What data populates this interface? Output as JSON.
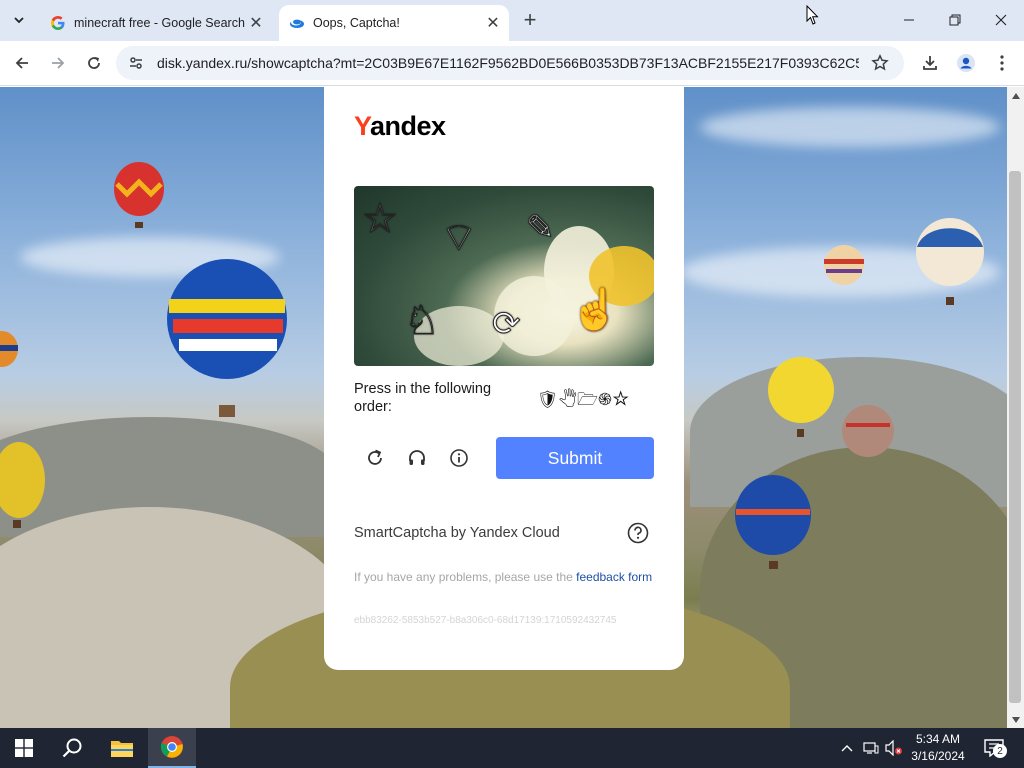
{
  "browser": {
    "tabs": [
      {
        "title": "minecraft free - Google Search",
        "favicon": "google-g-icon",
        "active": false
      },
      {
        "title": "Oops, Captcha!",
        "favicon": "yandex-disk-icon",
        "active": true
      }
    ],
    "address_bar": {
      "url": "disk.yandex.ru/showcaptcha?mt=2C03B9E67E1162F9562BD0E566B0353DB73F13ACBF2155E217F0393C62C5BAC..."
    }
  },
  "captcha": {
    "logo": {
      "first_letter": "Y",
      "rest": "andex"
    },
    "instruction": "Press in the following order:",
    "order_symbols": "🛡🖑🗁֍☆",
    "submit_label": "Submit",
    "footer": "SmartCaptcha by Yandex Cloud",
    "problems_text": "If you have any problems, please use the ",
    "feedback_link": "feedback form",
    "request_id": "ebb83262-5853b527-b8a306c0-68d17139:1710592432745",
    "captcha_image_symbols": [
      "☆",
      "⌔",
      "✎",
      "♘",
      "⟳",
      "☝"
    ]
  },
  "taskbar": {
    "time": "5:34 AM",
    "date": "3/16/2024",
    "notification_count": "2"
  }
}
